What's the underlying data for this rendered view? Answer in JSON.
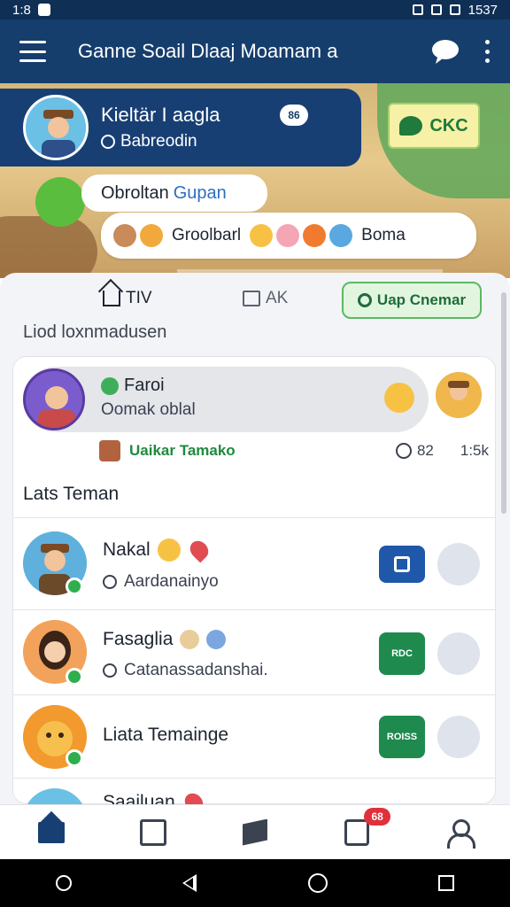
{
  "status_bar": {
    "time": "1:8",
    "battery": "1537"
  },
  "app_bar": {
    "title": "Ganne Soail Dlaaj Moamam a"
  },
  "profile": {
    "name": "Kieltär I aagla",
    "subtitle": "Babreodin",
    "badge": "86"
  },
  "chk_button": {
    "label": "CKC"
  },
  "group": {
    "name_part1": "Obroltan",
    "name_part2": "Gupan"
  },
  "reactions": {
    "text": "Groolbarl",
    "label": "Boma"
  },
  "tabs": {
    "home_label": "TIV",
    "ak_label": "AK",
    "group_button": "Uap Cnemar"
  },
  "section_label": "Liod loxnmadusen",
  "recent": {
    "name": "Faroi",
    "message": "Oomak oblal",
    "meta_link": "Uaikar Tamako",
    "meta_count": "82",
    "meta_extra": "1:5k"
  },
  "friends_header": "Lats Teman",
  "friends": [
    {
      "name": "Nakal",
      "subtitle": "Aardanainyo",
      "action_color": "#1f58a8",
      "action_label": ""
    },
    {
      "name": "Fasaglia",
      "subtitle": "Catanassadanshai.",
      "action_color": "#1e8a4e",
      "action_label": "RDC"
    },
    {
      "name": "Liata Temainge",
      "subtitle": "",
      "action_color": "#1e8a4e",
      "action_label": "ROISS"
    },
    {
      "name": "Saailuan",
      "subtitle": "",
      "action_color": "#1e8a4e",
      "action_label": ""
    }
  ],
  "bottom_nav": {
    "badge": "68"
  },
  "colors": {
    "primary": "#163e6d",
    "accent_green": "#1e8a4e",
    "badge_red": "#e0303a"
  }
}
